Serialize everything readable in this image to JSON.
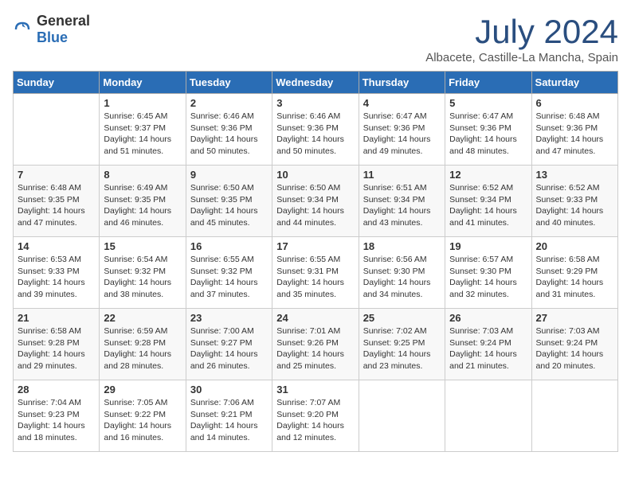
{
  "header": {
    "logo_general": "General",
    "logo_blue": "Blue",
    "title": "July 2024",
    "location": "Albacete, Castille-La Mancha, Spain"
  },
  "days_of_week": [
    "Sunday",
    "Monday",
    "Tuesday",
    "Wednesday",
    "Thursday",
    "Friday",
    "Saturday"
  ],
  "weeks": [
    [
      {
        "num": "",
        "info": ""
      },
      {
        "num": "1",
        "info": "Sunrise: 6:45 AM\nSunset: 9:37 PM\nDaylight: 14 hours\nand 51 minutes."
      },
      {
        "num": "2",
        "info": "Sunrise: 6:46 AM\nSunset: 9:36 PM\nDaylight: 14 hours\nand 50 minutes."
      },
      {
        "num": "3",
        "info": "Sunrise: 6:46 AM\nSunset: 9:36 PM\nDaylight: 14 hours\nand 50 minutes."
      },
      {
        "num": "4",
        "info": "Sunrise: 6:47 AM\nSunset: 9:36 PM\nDaylight: 14 hours\nand 49 minutes."
      },
      {
        "num": "5",
        "info": "Sunrise: 6:47 AM\nSunset: 9:36 PM\nDaylight: 14 hours\nand 48 minutes."
      },
      {
        "num": "6",
        "info": "Sunrise: 6:48 AM\nSunset: 9:36 PM\nDaylight: 14 hours\nand 47 minutes."
      }
    ],
    [
      {
        "num": "7",
        "info": "Sunrise: 6:48 AM\nSunset: 9:35 PM\nDaylight: 14 hours\nand 47 minutes."
      },
      {
        "num": "8",
        "info": "Sunrise: 6:49 AM\nSunset: 9:35 PM\nDaylight: 14 hours\nand 46 minutes."
      },
      {
        "num": "9",
        "info": "Sunrise: 6:50 AM\nSunset: 9:35 PM\nDaylight: 14 hours\nand 45 minutes."
      },
      {
        "num": "10",
        "info": "Sunrise: 6:50 AM\nSunset: 9:34 PM\nDaylight: 14 hours\nand 44 minutes."
      },
      {
        "num": "11",
        "info": "Sunrise: 6:51 AM\nSunset: 9:34 PM\nDaylight: 14 hours\nand 43 minutes."
      },
      {
        "num": "12",
        "info": "Sunrise: 6:52 AM\nSunset: 9:34 PM\nDaylight: 14 hours\nand 41 minutes."
      },
      {
        "num": "13",
        "info": "Sunrise: 6:52 AM\nSunset: 9:33 PM\nDaylight: 14 hours\nand 40 minutes."
      }
    ],
    [
      {
        "num": "14",
        "info": "Sunrise: 6:53 AM\nSunset: 9:33 PM\nDaylight: 14 hours\nand 39 minutes."
      },
      {
        "num": "15",
        "info": "Sunrise: 6:54 AM\nSunset: 9:32 PM\nDaylight: 14 hours\nand 38 minutes."
      },
      {
        "num": "16",
        "info": "Sunrise: 6:55 AM\nSunset: 9:32 PM\nDaylight: 14 hours\nand 37 minutes."
      },
      {
        "num": "17",
        "info": "Sunrise: 6:55 AM\nSunset: 9:31 PM\nDaylight: 14 hours\nand 35 minutes."
      },
      {
        "num": "18",
        "info": "Sunrise: 6:56 AM\nSunset: 9:30 PM\nDaylight: 14 hours\nand 34 minutes."
      },
      {
        "num": "19",
        "info": "Sunrise: 6:57 AM\nSunset: 9:30 PM\nDaylight: 14 hours\nand 32 minutes."
      },
      {
        "num": "20",
        "info": "Sunrise: 6:58 AM\nSunset: 9:29 PM\nDaylight: 14 hours\nand 31 minutes."
      }
    ],
    [
      {
        "num": "21",
        "info": "Sunrise: 6:58 AM\nSunset: 9:28 PM\nDaylight: 14 hours\nand 29 minutes."
      },
      {
        "num": "22",
        "info": "Sunrise: 6:59 AM\nSunset: 9:28 PM\nDaylight: 14 hours\nand 28 minutes."
      },
      {
        "num": "23",
        "info": "Sunrise: 7:00 AM\nSunset: 9:27 PM\nDaylight: 14 hours\nand 26 minutes."
      },
      {
        "num": "24",
        "info": "Sunrise: 7:01 AM\nSunset: 9:26 PM\nDaylight: 14 hours\nand 25 minutes."
      },
      {
        "num": "25",
        "info": "Sunrise: 7:02 AM\nSunset: 9:25 PM\nDaylight: 14 hours\nand 23 minutes."
      },
      {
        "num": "26",
        "info": "Sunrise: 7:03 AM\nSunset: 9:24 PM\nDaylight: 14 hours\nand 21 minutes."
      },
      {
        "num": "27",
        "info": "Sunrise: 7:03 AM\nSunset: 9:24 PM\nDaylight: 14 hours\nand 20 minutes."
      }
    ],
    [
      {
        "num": "28",
        "info": "Sunrise: 7:04 AM\nSunset: 9:23 PM\nDaylight: 14 hours\nand 18 minutes."
      },
      {
        "num": "29",
        "info": "Sunrise: 7:05 AM\nSunset: 9:22 PM\nDaylight: 14 hours\nand 16 minutes."
      },
      {
        "num": "30",
        "info": "Sunrise: 7:06 AM\nSunset: 9:21 PM\nDaylight: 14 hours\nand 14 minutes."
      },
      {
        "num": "31",
        "info": "Sunrise: 7:07 AM\nSunset: 9:20 PM\nDaylight: 14 hours\nand 12 minutes."
      },
      {
        "num": "",
        "info": ""
      },
      {
        "num": "",
        "info": ""
      },
      {
        "num": "",
        "info": ""
      }
    ]
  ]
}
